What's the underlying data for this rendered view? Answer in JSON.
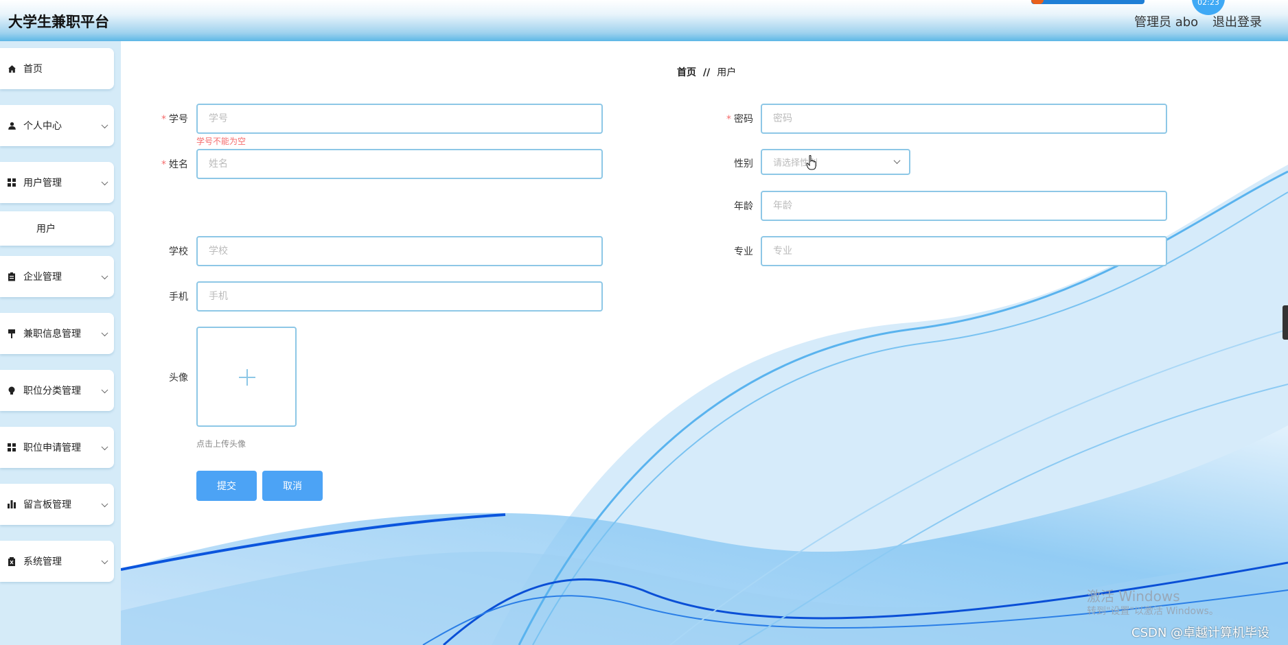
{
  "header": {
    "app_title": "大学生兼职平台",
    "user_info": "管理员 abo",
    "logout_label": "退出登录",
    "clock_text": "02:23"
  },
  "sidebar": {
    "items": [
      {
        "label": "首页",
        "icon": "home-icon"
      },
      {
        "label": "个人中心",
        "icon": "user-icon"
      },
      {
        "label": "用户管理",
        "icon": "grid-icon"
      },
      {
        "label": "用户",
        "icon": ""
      },
      {
        "label": "企业管理",
        "icon": "clipboard-icon"
      },
      {
        "label": "兼职信息管理",
        "icon": "flag-icon"
      },
      {
        "label": "职位分类管理",
        "icon": "bulb-icon"
      },
      {
        "label": "职位申请管理",
        "icon": "grid-icon"
      },
      {
        "label": "留言板管理",
        "icon": "bar-chart-icon"
      },
      {
        "label": "系统管理",
        "icon": "trash-icon"
      }
    ]
  },
  "breadcrumb": {
    "home": "首页",
    "separator": "//",
    "current": "用户"
  },
  "form": {
    "xuehao": {
      "label": "学号",
      "placeholder": "学号",
      "error": "学号不能为空"
    },
    "mima": {
      "label": "密码",
      "placeholder": "密码"
    },
    "xingming": {
      "label": "姓名",
      "placeholder": "姓名"
    },
    "xingbie": {
      "label": "性别",
      "placeholder": "请选择性别"
    },
    "nianling": {
      "label": "年龄",
      "placeholder": "年龄"
    },
    "xuexiao": {
      "label": "学校",
      "placeholder": "学校"
    },
    "zhuanye": {
      "label": "专业",
      "placeholder": "专业"
    },
    "shouji": {
      "label": "手机",
      "placeholder": "手机"
    },
    "touxiang": {
      "label": "头像",
      "hint": "点击上传头像"
    },
    "submit_label": "提交",
    "cancel_label": "取消"
  },
  "overlay": {
    "activate_windows": "激活 Windows",
    "activate_hint": "转到\"设置\"以激活 Windows。",
    "csdn_watermark": "CSDN @卓越计算机毕设"
  },
  "colors": {
    "accent": "#4ca3f5",
    "input_border": "#8dc7e6",
    "error": "#f56c6c",
    "sidebar_bg": "#d5ebf8"
  }
}
